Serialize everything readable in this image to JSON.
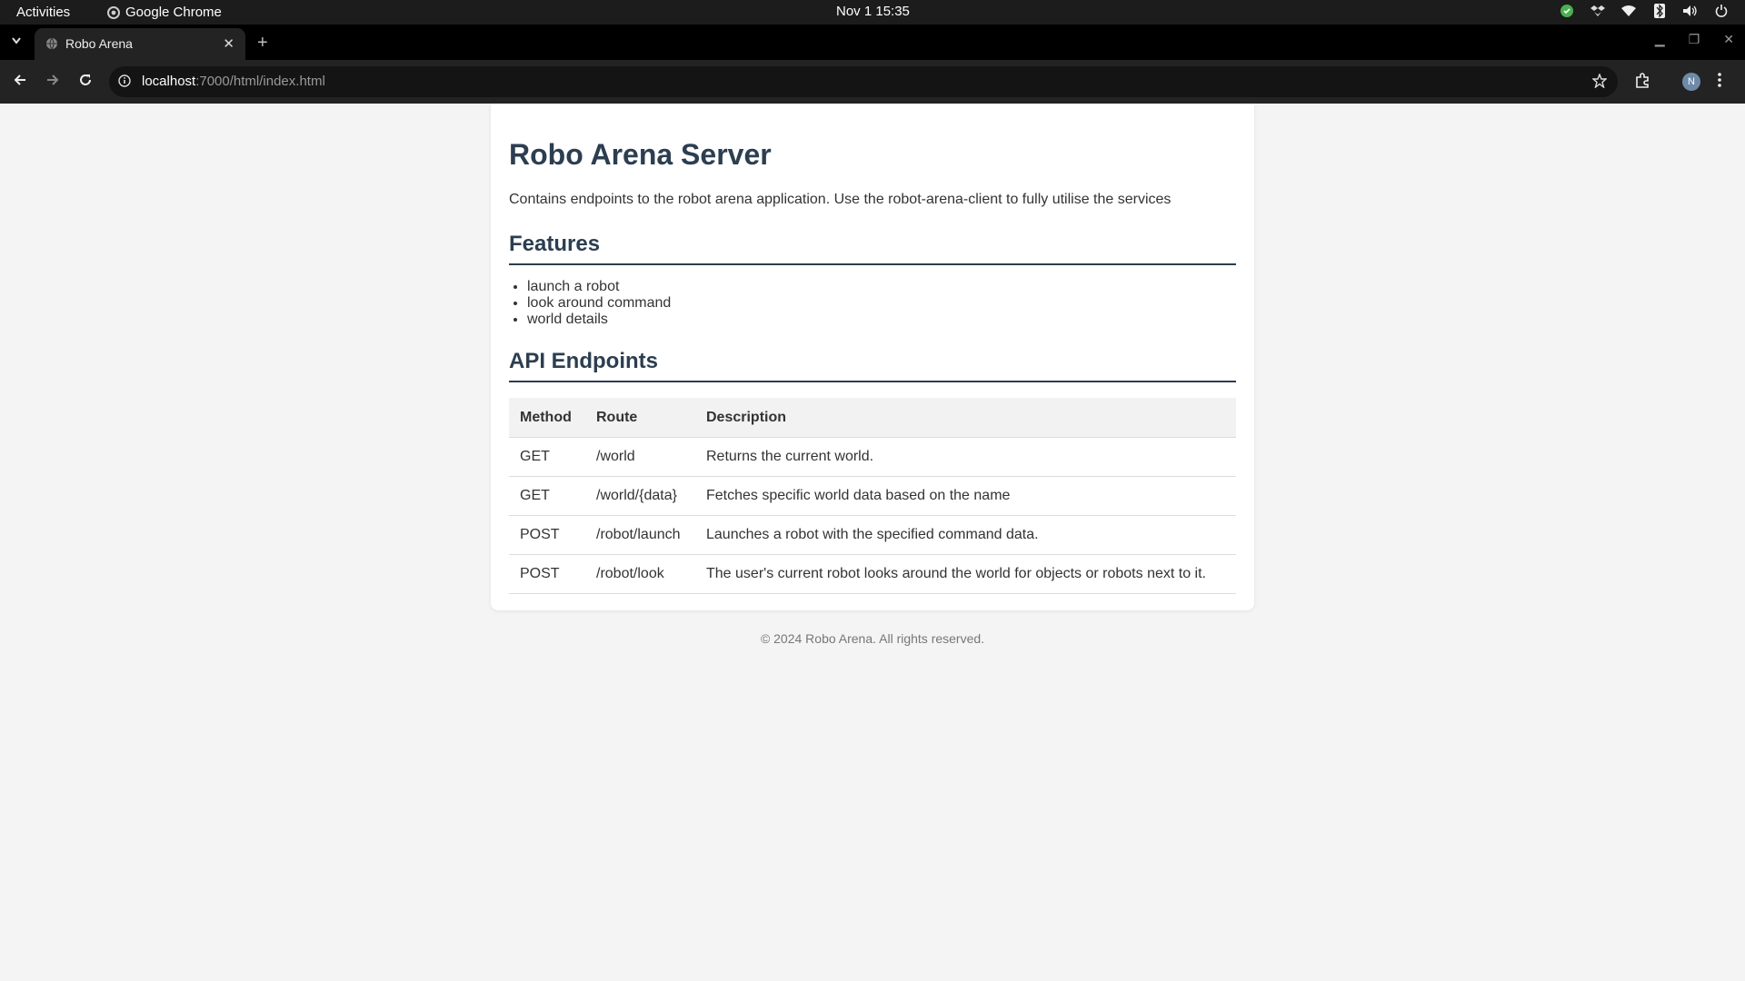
{
  "system_bar": {
    "activities": "Activities",
    "app_name": "Google Chrome",
    "clock": "Nov 1  15:35"
  },
  "browser": {
    "tab_title": "Robo Arena",
    "url_host": "localhost",
    "url_rest": ":7000/html/index.html",
    "profile_initial": "N"
  },
  "page": {
    "title": "Robo Arena Server",
    "description": "Contains endpoints to the robot arena application. Use the robot-arena-client to fully utilise the services",
    "features_heading": "Features",
    "features": [
      "launch a robot",
      "look around command",
      "world details"
    ],
    "api_heading": "API Endpoints",
    "table": {
      "headers": [
        "Method",
        "Route",
        "Description"
      ],
      "rows": [
        [
          "GET",
          "/world",
          "Returns the current world."
        ],
        [
          "GET",
          "/world/{data}",
          "Fetches specific world data based on the name"
        ],
        [
          "POST",
          "/robot/launch",
          "Launches a robot with the specified command data."
        ],
        [
          "POST",
          "/robot/look",
          "The user's current robot looks around the world for objects or robots next to it."
        ]
      ]
    },
    "footer": "© 2024 Robo Arena. All rights reserved."
  },
  "colors": {
    "heading": "#2c3e50",
    "page_bg": "#f4f4f4",
    "table_header_bg": "#f2f2f2"
  }
}
